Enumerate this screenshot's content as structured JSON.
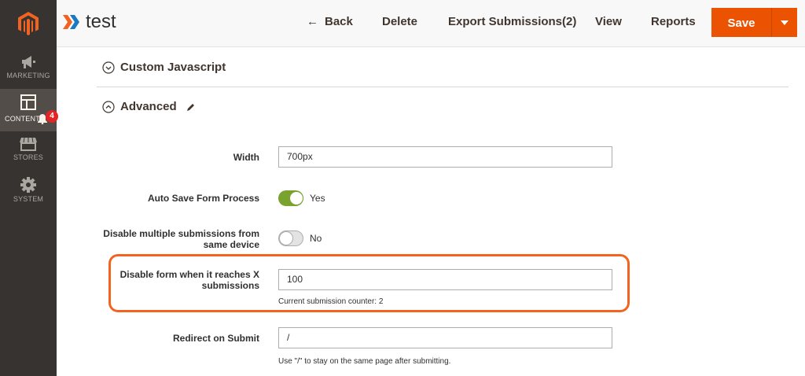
{
  "sidebar": {
    "items": [
      {
        "label": "MARKETING",
        "icon": "megaphone-icon"
      },
      {
        "label": "CONTENT",
        "icon": "layout-icon",
        "active": true
      },
      {
        "label": "STORES",
        "icon": "storefront-icon"
      },
      {
        "label": "SYSTEM",
        "icon": "gear-icon"
      }
    ],
    "notification_count": "4"
  },
  "header": {
    "title": "test",
    "actions": {
      "back": "Back",
      "delete": "Delete",
      "export": "Export Submissions(2)",
      "view": "View",
      "reports": "Reports"
    },
    "save_label": "Save"
  },
  "sections": {
    "custom_js": "Custom Javascript",
    "advanced": "Advanced"
  },
  "form": {
    "width": {
      "label": "Width",
      "value": "700px"
    },
    "auto_save": {
      "label": "Auto Save Form Process",
      "state": "Yes"
    },
    "disable_multiple": {
      "label_line1": "Disable multiple submissions from",
      "label_line2": "same device",
      "state": "No"
    },
    "disable_limit": {
      "label_line1": "Disable form when it reaches X",
      "label_line2": "submissions",
      "value": "100",
      "note": "Current submission counter: 2"
    },
    "redirect": {
      "label": "Redirect on Submit",
      "value": "/",
      "note": "Use \"/\" to stay on the same page after submitting."
    }
  },
  "colors": {
    "accent": "#eb5202",
    "highlight": "#f16422",
    "toggle_on": "#79a22e",
    "sidebar": "#373330"
  }
}
